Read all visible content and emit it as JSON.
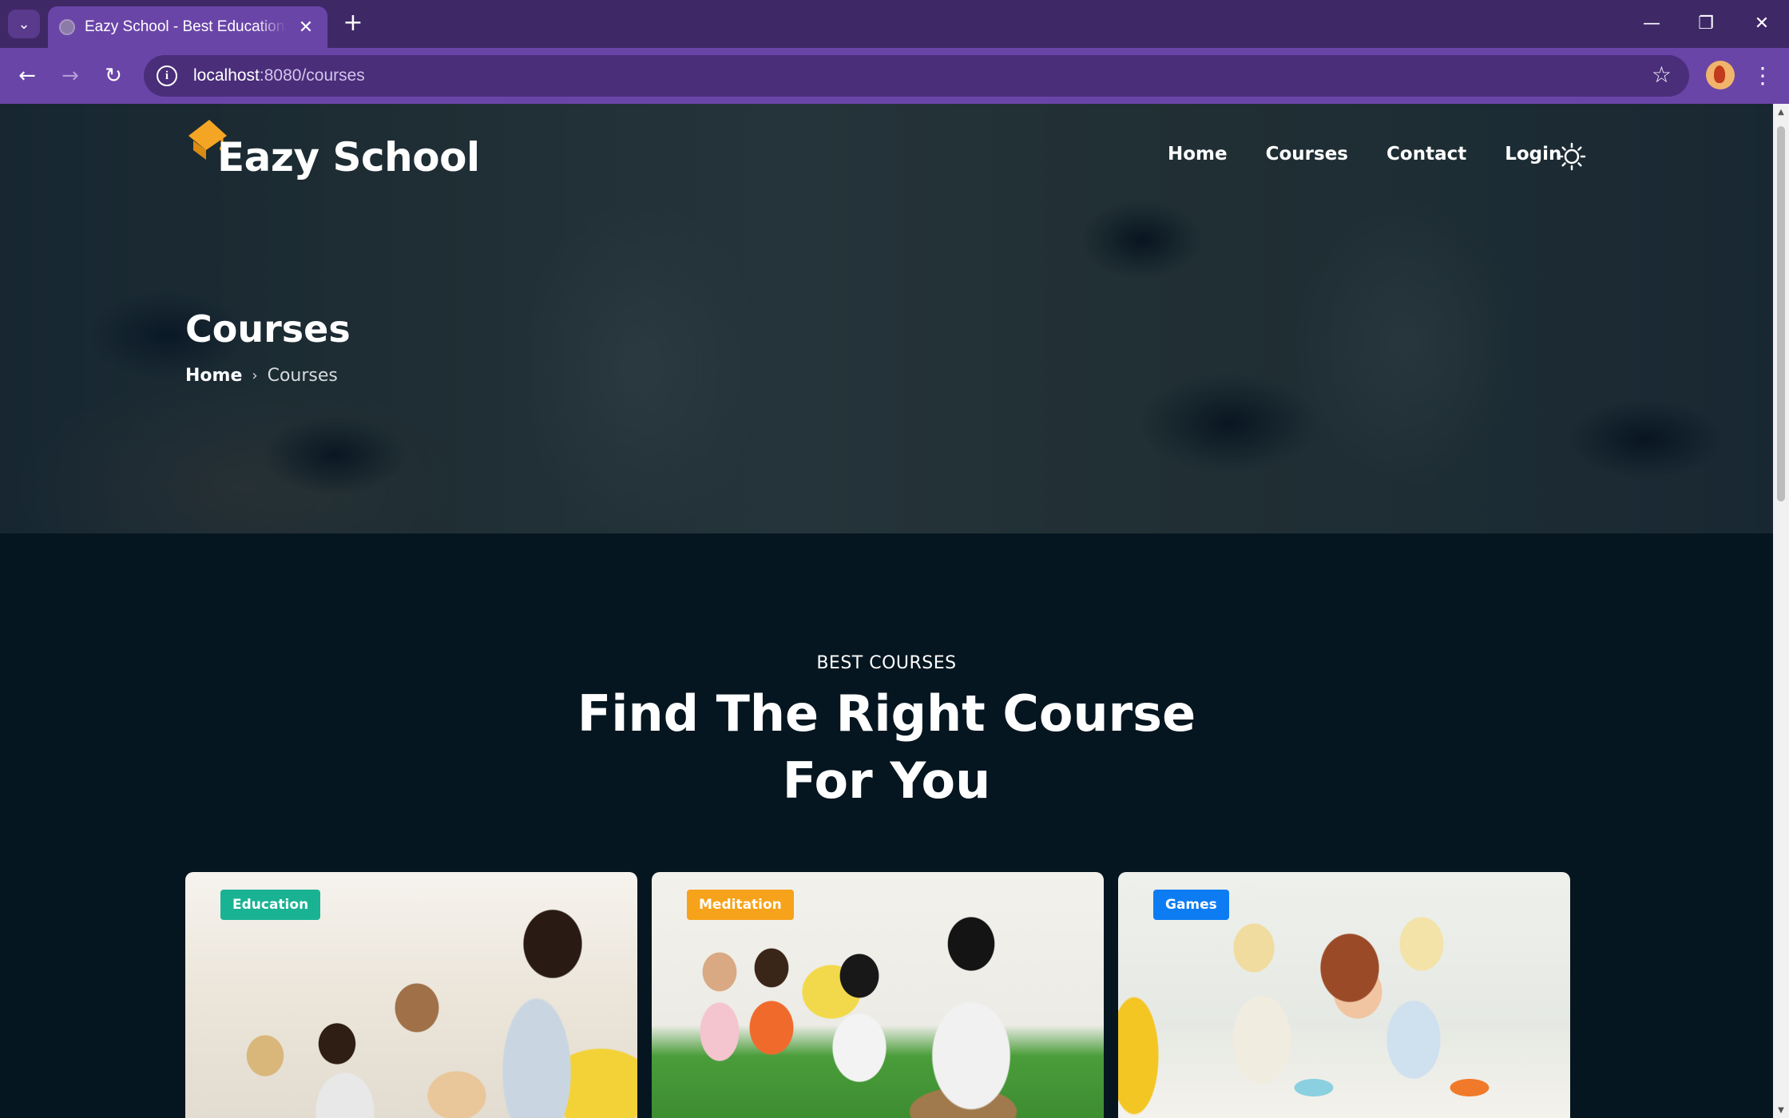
{
  "browser": {
    "tab_title": "Eazy School - Best Educational Institute",
    "url_host": "localhost",
    "url_rest": ":8080/courses",
    "new_tab": "+",
    "tab_close": "✕",
    "minimize": "—",
    "restore": "❐",
    "close": "✕",
    "back": "←",
    "forward": "→",
    "reload": "↻",
    "site_info": "i",
    "bookmark": "☆",
    "menu": "⋮",
    "tab_list": "⌄"
  },
  "site": {
    "logo_text": "Eazy School",
    "nav": [
      "Home",
      "Courses",
      "Contact",
      "Login"
    ],
    "accent_color": "#f5a524"
  },
  "hero": {
    "title": "Courses",
    "breadcrumb_home": "Home",
    "breadcrumb_sep": "›",
    "breadcrumb_current": "Courses"
  },
  "section": {
    "eyebrow": "BEST COURSES",
    "title_line1": "Find The Right Course",
    "title_line2": "For You"
  },
  "courses": [
    {
      "badge": "Education",
      "badge_color": "#19b394"
    },
    {
      "badge": "Meditation",
      "badge_color": "#f7a21b"
    },
    {
      "badge": "Games",
      "badge_color": "#0d7cf2"
    }
  ]
}
